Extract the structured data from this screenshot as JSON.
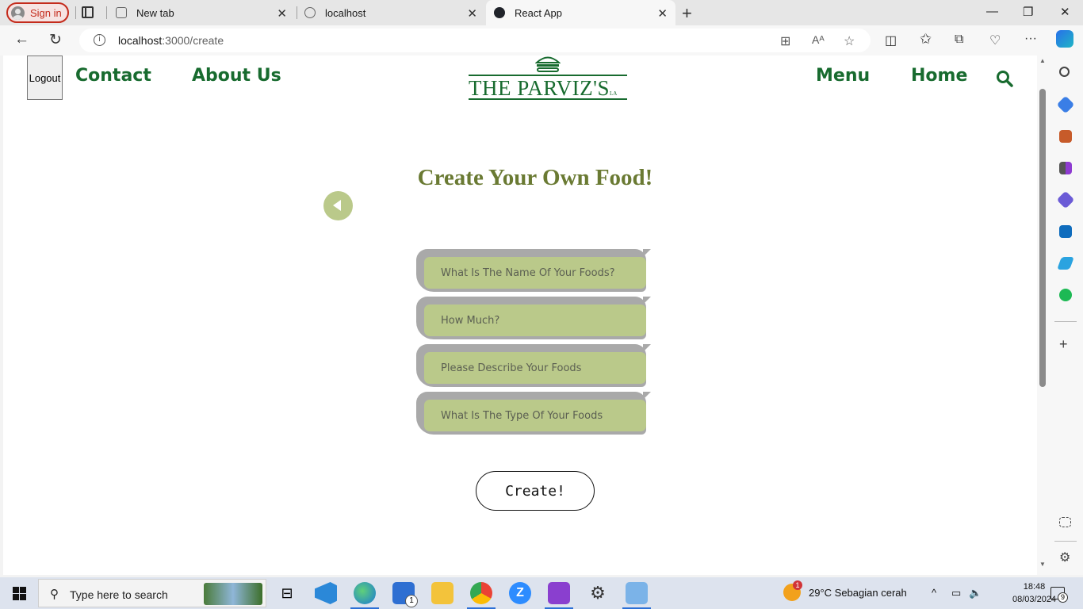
{
  "browser": {
    "signin_label": "Sign in",
    "tabs": [
      {
        "title": "New tab",
        "active": false
      },
      {
        "title": "localhost",
        "active": false
      },
      {
        "title": "React App",
        "active": true
      }
    ],
    "url_host": "localhost",
    "url_path": ":3000/create"
  },
  "page": {
    "logout_label": "Logout",
    "nav_left": [
      "Contact",
      "About Us"
    ],
    "nav_right": [
      "Menu",
      "Home"
    ],
    "logo_text": "THE PARVIZ'S",
    "logo_suffix": "LA",
    "title": "Create Your Own Food!",
    "fields": [
      {
        "placeholder": "What Is The Name Of Your Foods?"
      },
      {
        "placeholder": "How Much?"
      },
      {
        "placeholder": "Please Describe Your Foods"
      },
      {
        "placeholder": "What Is The Type Of Your Foods"
      }
    ],
    "create_label": "Create!",
    "accent_color": "#186b2f",
    "field_color": "#bac98a",
    "title_color": "#6a7a33"
  },
  "taskbar": {
    "search_placeholder": "Type here to search",
    "weather": "29°C  Sebagian cerah",
    "weather_badge": "1",
    "mail_badge": "1",
    "time": "18:48",
    "date": "08/03/2024",
    "notification_count": "9"
  }
}
